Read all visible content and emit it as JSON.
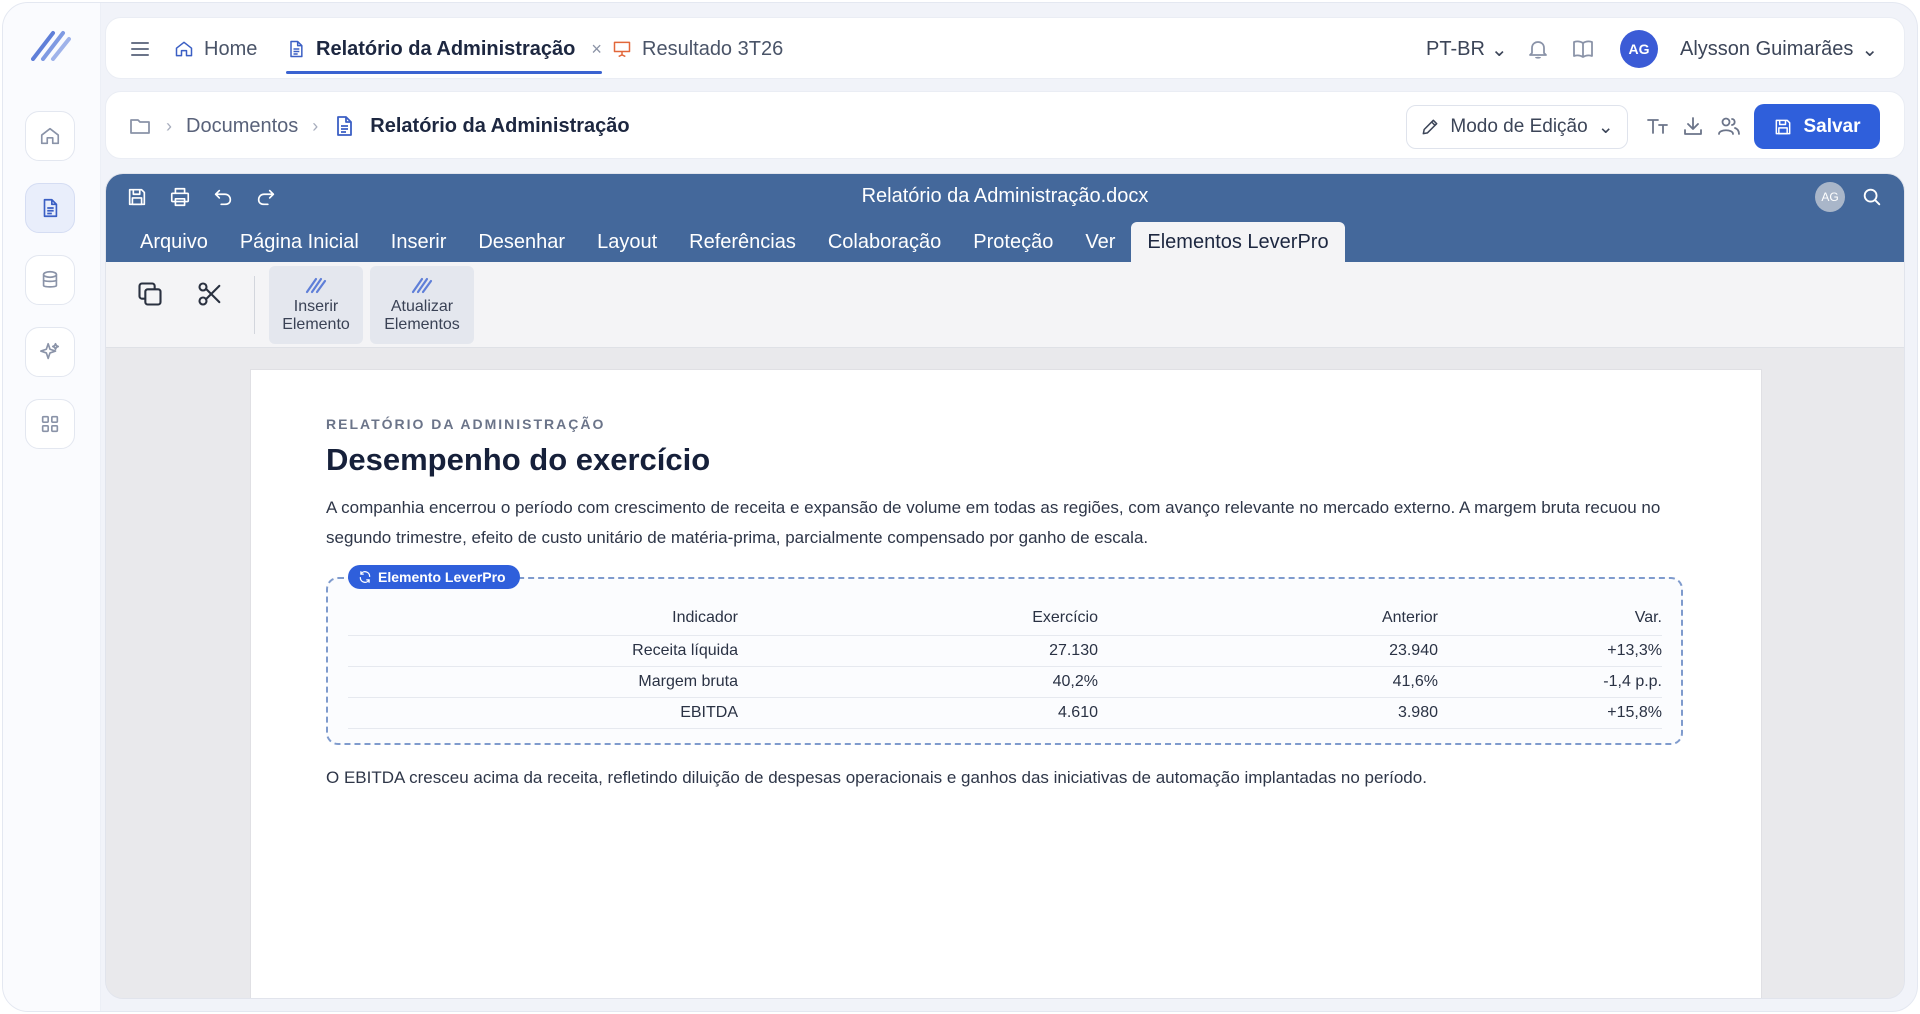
{
  "topbar": {
    "tabs": [
      {
        "label": "Home",
        "icon": "home-icon"
      },
      {
        "label": "Relatório da Administração",
        "icon": "document-icon",
        "active": true,
        "close": "×"
      },
      {
        "label": "Resultado 3T26",
        "icon": "presentation-icon"
      }
    ],
    "language": "PT-BR",
    "avatar_initials": "AG",
    "user_name": "Alysson Guimarães",
    "chevron": "⌄"
  },
  "breadcrumb": {
    "root": "Documentos",
    "separator": "›",
    "current": "Relatório da Administração",
    "mode_label": "Modo de Edição",
    "save_label": "Salvar"
  },
  "editor": {
    "doc_name": "Relatório da Administração.docx",
    "avatar_initials": "AG",
    "ribbon_tabs": [
      "Arquivo",
      "Página Inicial",
      "Inserir",
      "Desenhar",
      "Layout",
      "Referências",
      "Colaboração",
      "Proteção",
      "Ver",
      "Elementos LeverPro"
    ],
    "active_ribbon_tab": "Elementos LeverPro",
    "toolbar": {
      "insert_line1": "Inserir",
      "insert_line2": "Elemento",
      "update_line1": "Atualizar",
      "update_line2": "Elementos"
    }
  },
  "document": {
    "kicker": "RELATÓRIO DA ADMINISTRAÇÃO",
    "title": "Desempenho do exercício",
    "paragraph1": "A companhia encerrou o período com crescimento de receita e expansão de volume em todas as regiões, com avanço relevante no mercado externo. A margem bruta recuou no segundo trimestre, efeito de custo unitário de matéria-prima, parcialmente compensado por ganho de escala.",
    "element_badge": "Elemento LeverPro",
    "table": {
      "headers": [
        "Indicador",
        "Exercício",
        "Anterior",
        "Var."
      ],
      "rows": [
        [
          "Receita líquida",
          "27.130",
          "23.940",
          "+13,3%"
        ],
        [
          "Margem bruta",
          "40,2%",
          "41,6%",
          "-1,4 p.p."
        ],
        [
          "EBITDA",
          "4.610",
          "3.980",
          "+15,8%"
        ]
      ]
    },
    "paragraph2": "O EBITDA cresceu acima da receita, refletindo diluição de despesas operacionais e ganhos das iniciativas de automação implantadas no período."
  },
  "colors": {
    "accent": "#2f5fdb",
    "editor_header": "#44689b",
    "rail_active": "#e9eefb"
  }
}
